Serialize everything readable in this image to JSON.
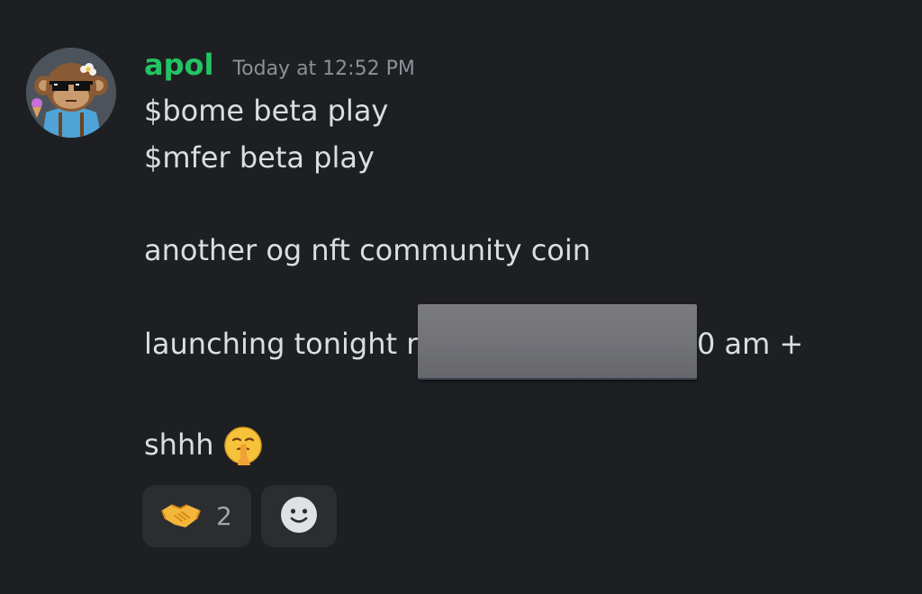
{
  "message": {
    "author": "apol",
    "timestamp": "Today at 12:52 PM",
    "lines": [
      "$bome beta play",
      "$mfer beta play",
      "another og nft community coin",
      "launching tonight r",
      "shhh"
    ],
    "line4_suffix": "0 am +",
    "inline_emoji": "shushing-face-icon"
  },
  "reactions": [
    {
      "icon": "handshake-icon",
      "count": "2"
    },
    {
      "icon": "add-reaction-icon"
    }
  ],
  "colors": {
    "background": "#1e1f22",
    "username": "#23c464",
    "timestamp": "#8d9097",
    "text": "#dbdee1",
    "reaction_bg": "#2b2d31"
  }
}
